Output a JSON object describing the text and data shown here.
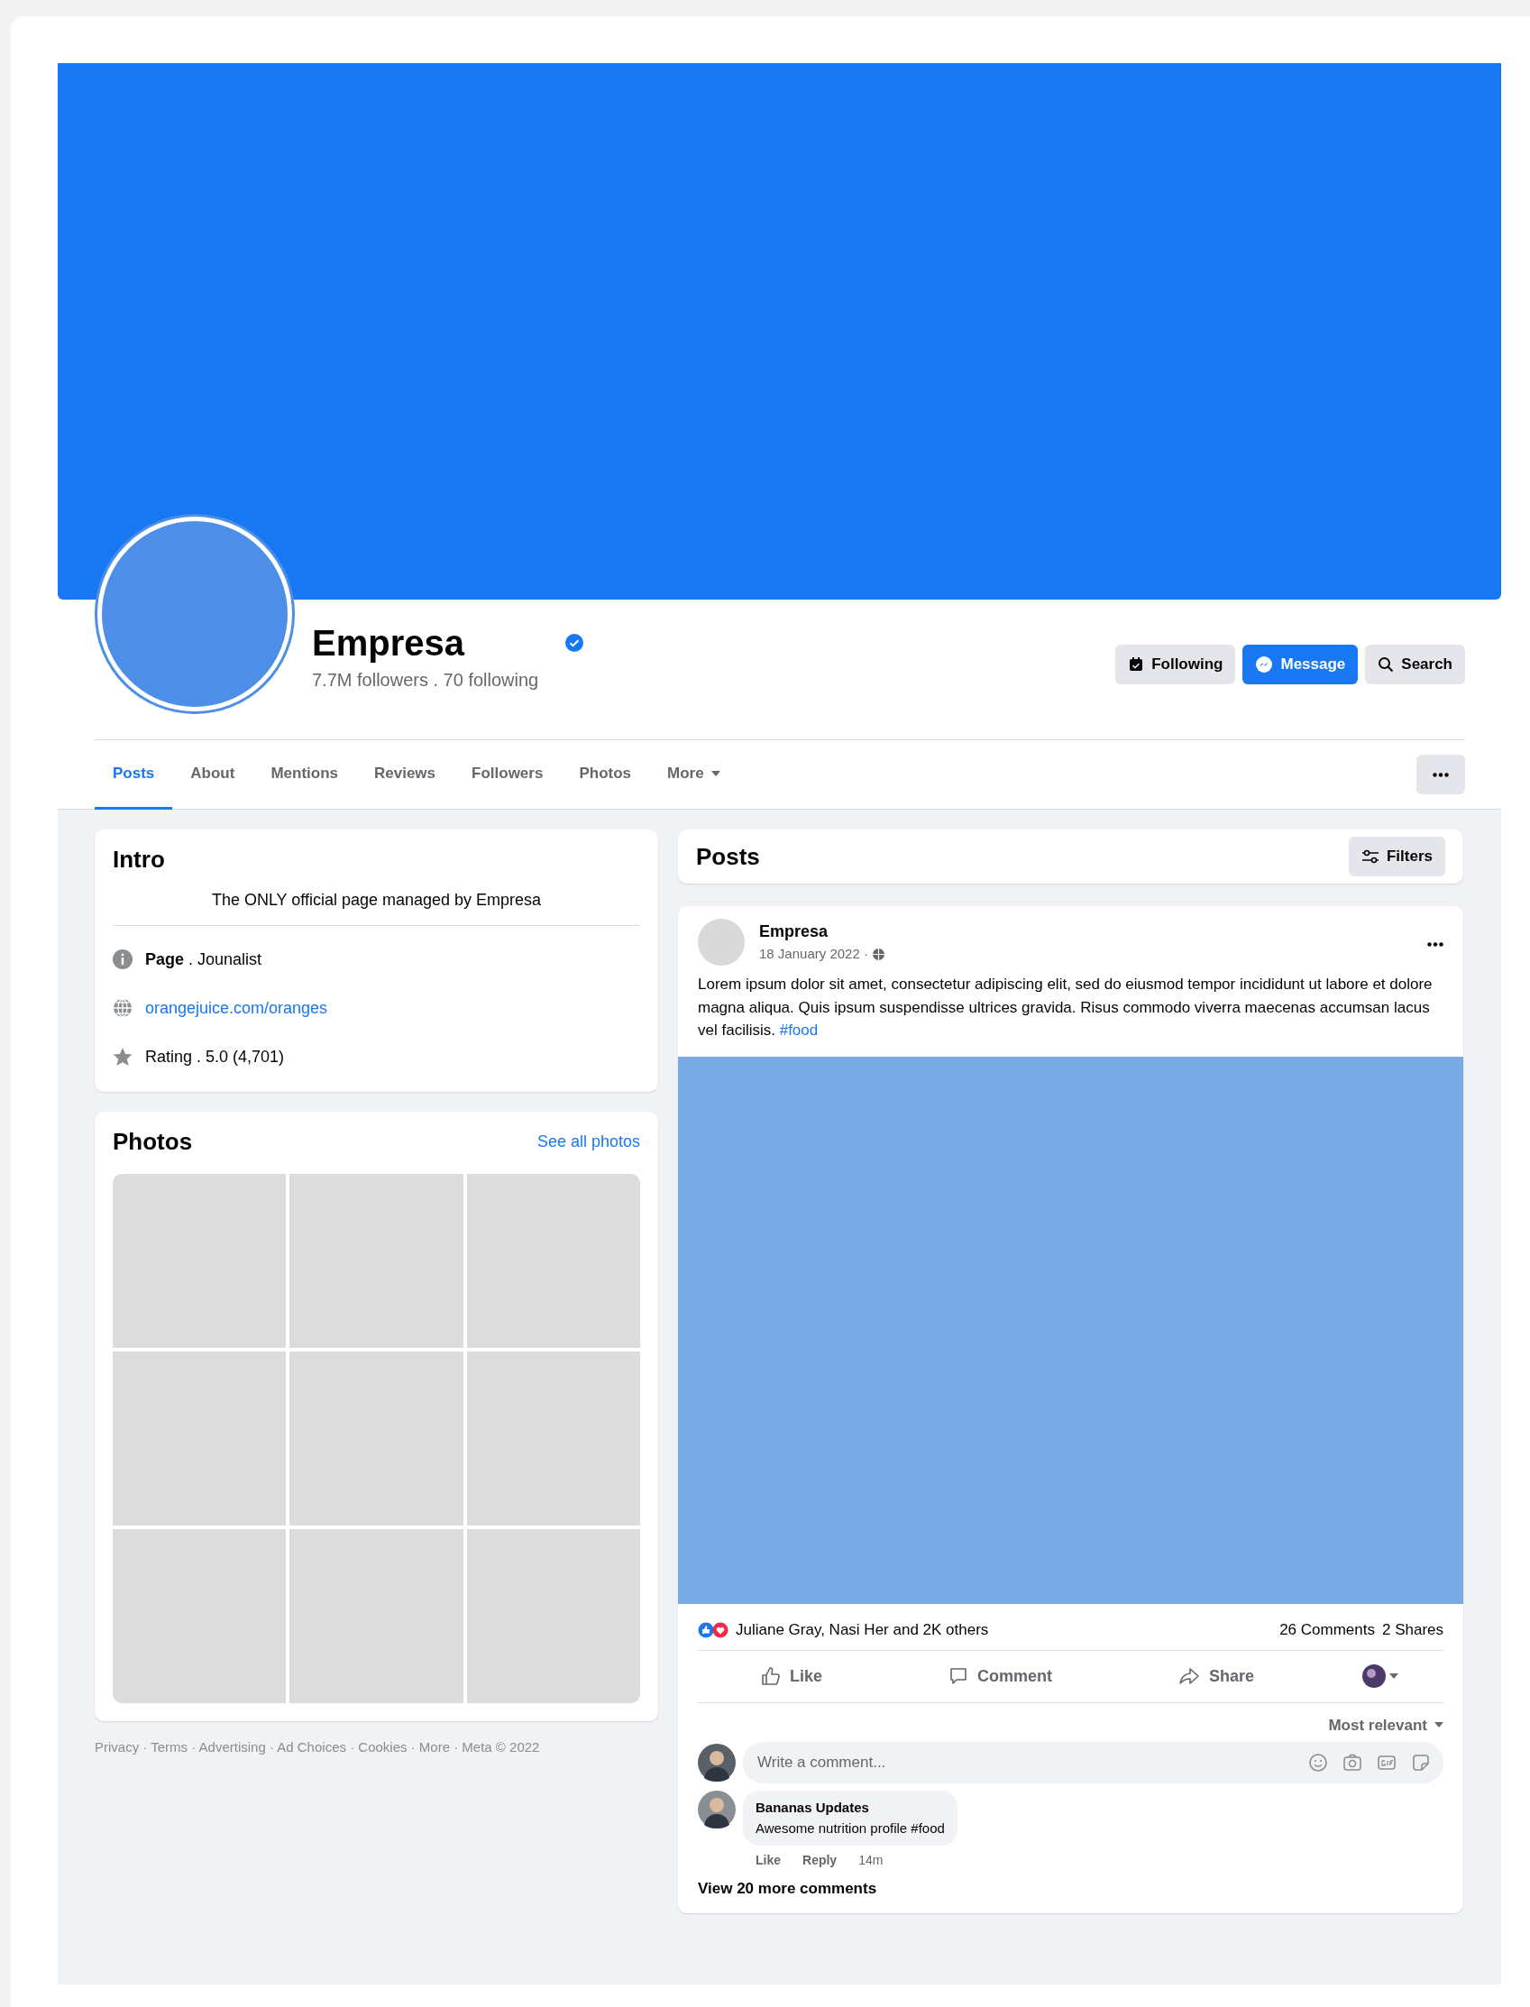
{
  "page": {
    "name": "Empresa",
    "verified": true,
    "stats": "7.7M followers . 70 following"
  },
  "actions": [
    {
      "label": "Following",
      "kind": "following"
    },
    {
      "label": "Message",
      "kind": "message"
    },
    {
      "label": "Search",
      "kind": "search"
    }
  ],
  "tabs": [
    {
      "label": "Posts",
      "selected": true
    },
    {
      "label": "About",
      "selected": false
    },
    {
      "label": "Mentions",
      "selected": false
    },
    {
      "label": "Reviews",
      "selected": false
    },
    {
      "label": "Followers",
      "selected": false
    },
    {
      "label": "Photos",
      "selected": false
    },
    {
      "label": "More",
      "selected": false,
      "dropdown": true
    }
  ],
  "intro": {
    "title": "Intro",
    "bio": "The ONLY official page managed by Empresa",
    "items": [
      {
        "kind": "category",
        "text": "**Page** . Jounalist"
      },
      {
        "kind": "link",
        "text": "orangejuice.com/oranges"
      },
      {
        "kind": "rating",
        "text": "Rating . 5.0 (4,701)"
      }
    ]
  },
  "photos": {
    "title": "Photos",
    "link": "See all photos",
    "tiles": [
      {
        "kind": "placeholder"
      },
      {
        "kind": "placeholder"
      },
      {
        "kind": "placeholder"
      },
      {
        "kind": "placeholder"
      },
      {
        "kind": "placeholder"
      },
      {
        "kind": "placeholder"
      },
      {
        "kind": "placeholder"
      },
      {
        "kind": "placeholder"
      },
      {
        "kind": "placeholder"
      }
    ]
  },
  "footer": "Privacy · Terms · Advertising · Ad Choices · Cookies · More · Meta © 2022",
  "posts_header": {
    "title": "Posts",
    "filter_button": "Filters"
  },
  "post": {
    "author": "Empresa",
    "date": "18 January 2022 ·",
    "public": true,
    "body": "Lorem ipsum dolor sit amet, consectetur adipiscing elit, sed do eiusmod tempor incididunt ut labore et dolore magna aliqua. Quis ipsum suspendisse ultrices gravida. Risus commodo viverra maecenas accumsan lacus vel facilisis.",
    "hashtag": "#food"
  },
  "reactions": {
    "summary": "Juliane Gray, Nasi Her and 2K others",
    "comments": "26 Comments",
    "shares": "2 Shares"
  },
  "post_actions": [
    {
      "label": "Like",
      "kind": "like"
    },
    {
      "label": "Comment",
      "kind": "comment"
    },
    {
      "label": "Share",
      "kind": "share"
    }
  ],
  "sort": "Most relevant",
  "comment_box": {
    "placeholder": "Write a comment..."
  },
  "comments": [
    {
      "author": "Bananas Updates",
      "text": "Awesome nutrition profile #food",
      "actions": [
        "Like",
        "Reply"
      ],
      "time": "14m"
    }
  ],
  "more_comments": "View 20 more comments"
}
